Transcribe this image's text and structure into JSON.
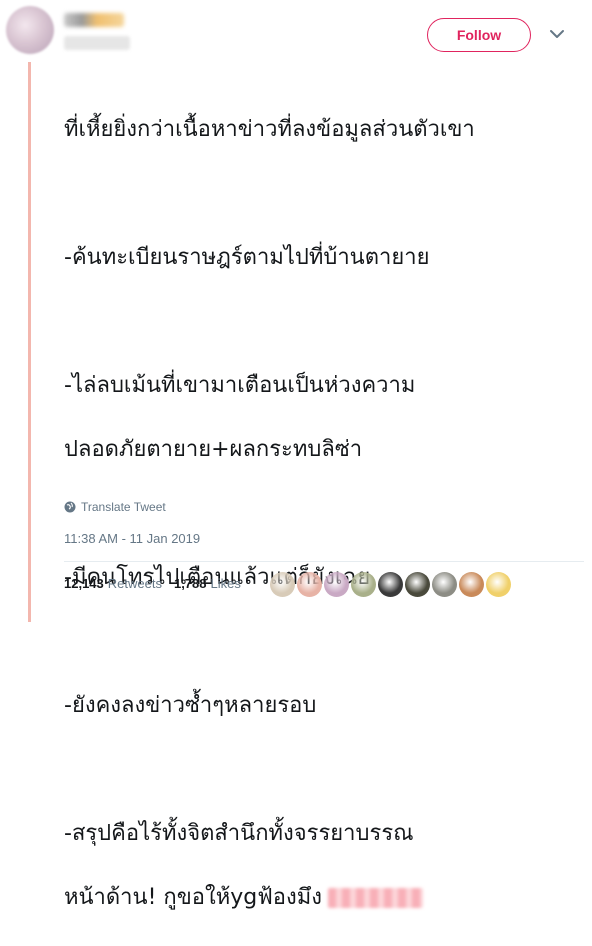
{
  "header": {
    "follow_label": "Follow"
  },
  "tweet": {
    "lines": [
      "ที่เหี้ยยิ่งกว่าเนื้อหาข่าวที่ลงข้อมูลส่วนตัวเขา",
      "",
      "-ค้นทะเบียนราษฎร์ตามไปที่บ้านตายาย",
      "",
      "-ไล่ลบเม้นที่เขามาเตือนเป็นห่วงความ",
      "ปลอดภัยตายาย+ผลกระทบลิซ่า",
      "",
      "-มีคนโทรไปเตือนแล้วแต่ก็ยังเฉย",
      "",
      "-ยังคงลงข่าวซ้ำๆหลายรอบ",
      "",
      "-สรุปคือไร้ทั้งจิตสำนึกทั้งจรรยาบรรณ"
    ],
    "last_line": "หน้าด้าน! กูขอให้ygฟ้องมึง",
    "translate_label": "Translate Tweet",
    "timestamp": "11:38 AM - 11 Jan 2019"
  },
  "stats": {
    "retweets_count": "12,143",
    "retweets_label": "Retweets",
    "likes_count": "1,788",
    "likes_label": "Likes"
  },
  "colors": {
    "accent": "#e0245e",
    "thread_line": "#f3b7ae",
    "muted_text": "#657786"
  },
  "likers": [
    {
      "color": "#d8cbb8"
    },
    {
      "color": "#e7b3a6"
    },
    {
      "color": "#c9a9c4"
    },
    {
      "color": "#a9b08a"
    },
    {
      "color": "#3a3a3a"
    },
    {
      "color": "#4a4a3c"
    },
    {
      "color": "#8d8d85"
    },
    {
      "color": "#c98a5a"
    },
    {
      "color": "#f0d06a"
    }
  ]
}
